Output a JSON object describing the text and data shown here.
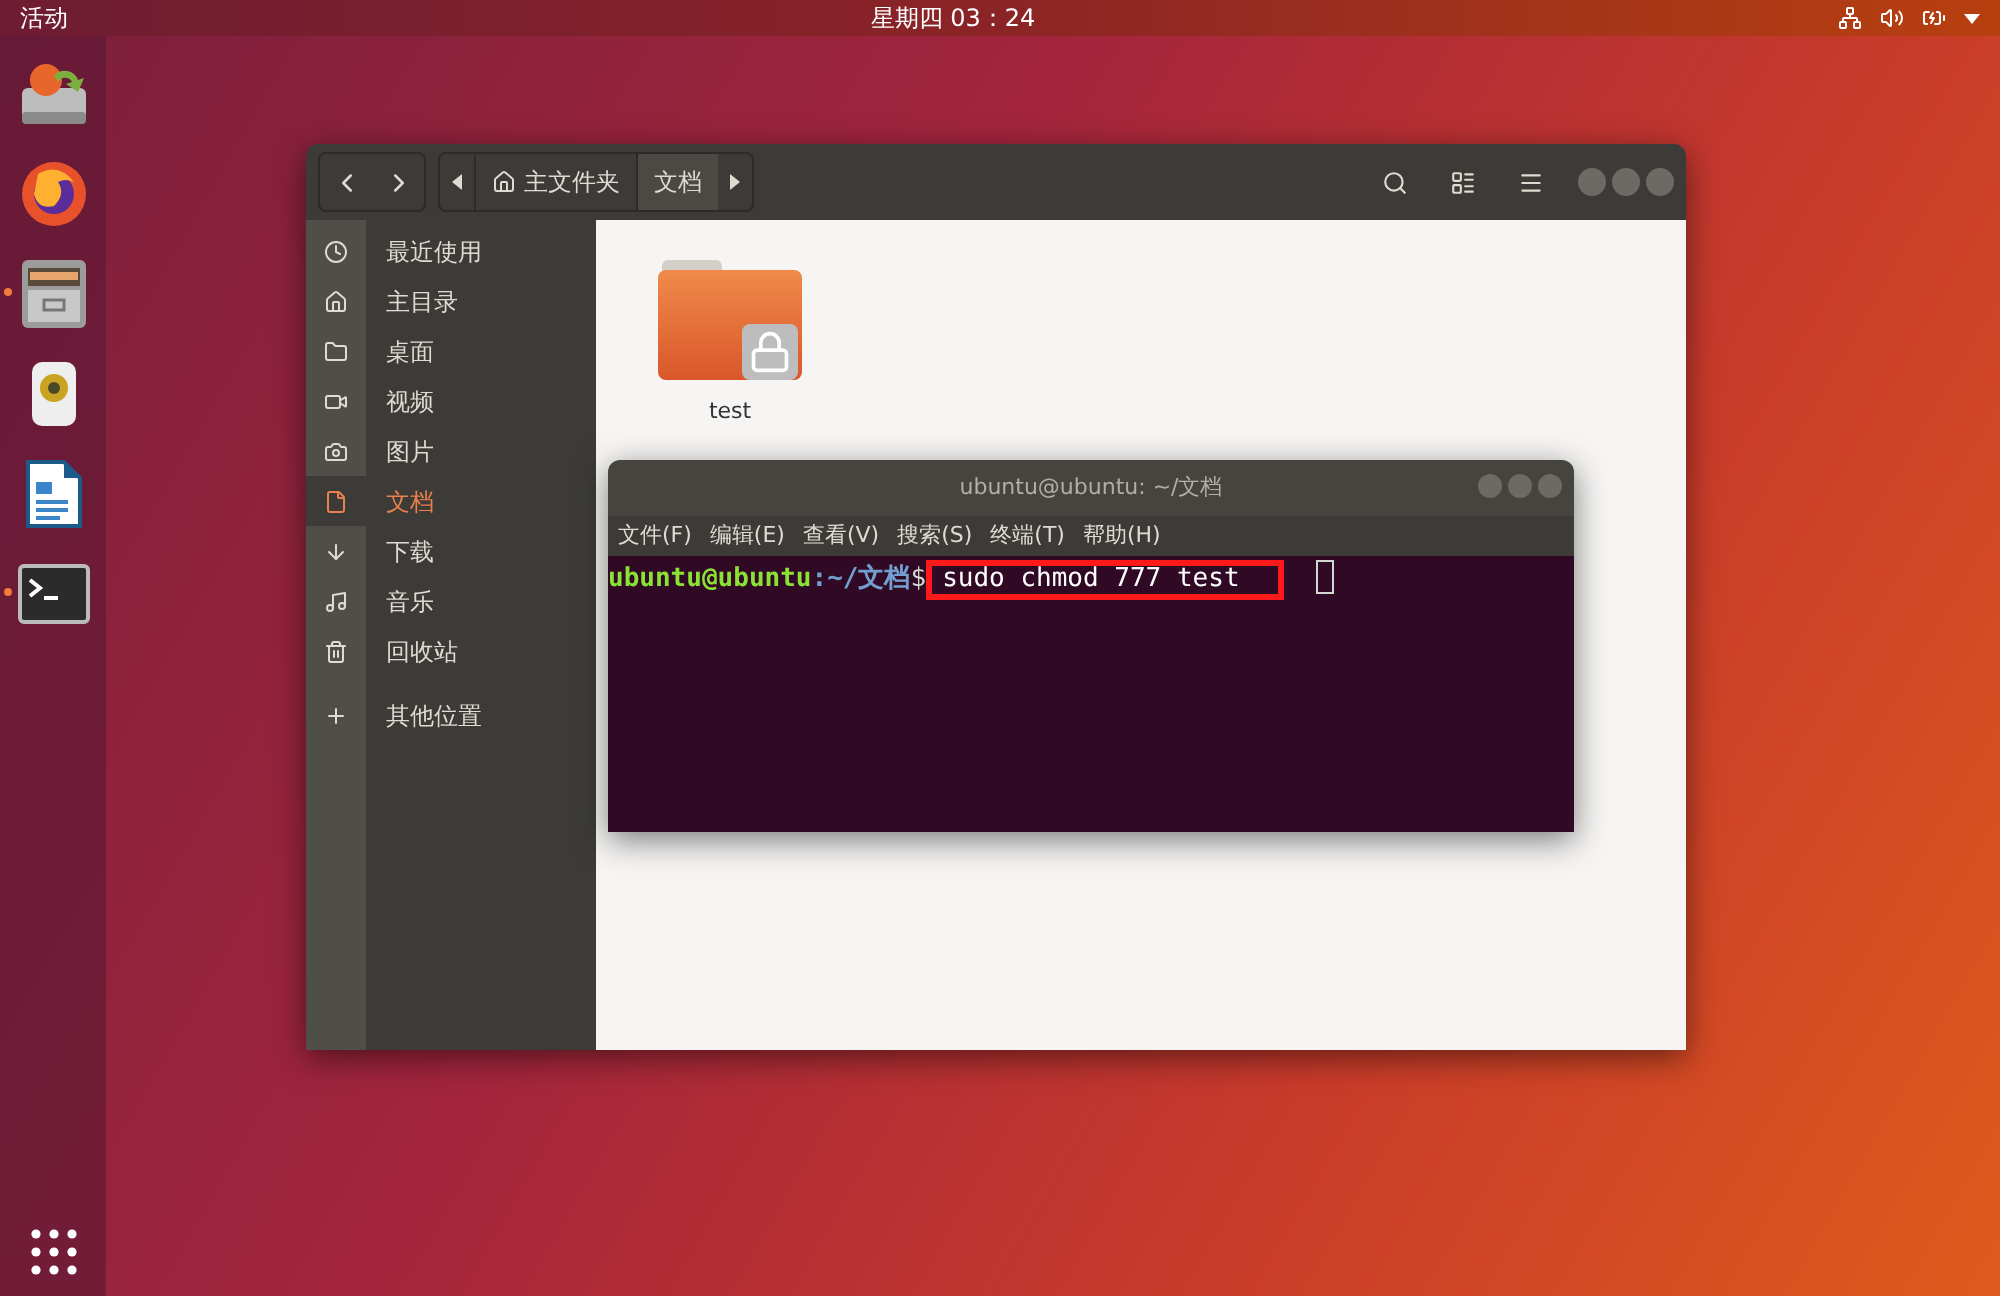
{
  "top_bar": {
    "activities": "活动",
    "clock": "星期四 03：24"
  },
  "dock": [
    {
      "kind": "installer",
      "running": false
    },
    {
      "kind": "browser",
      "running": false
    },
    {
      "kind": "files",
      "running": true
    },
    {
      "kind": "music",
      "running": false
    },
    {
      "kind": "writer",
      "running": false
    },
    {
      "kind": "terminal",
      "running": true
    }
  ],
  "files_window": {
    "breadcrumbs": [
      {
        "label": "主文件夹",
        "kind": "home",
        "selected": false
      },
      {
        "label": "文档",
        "kind": "folder",
        "selected": true
      }
    ],
    "sidebar": [
      {
        "label": "最近使用",
        "kind": "recent",
        "selected": false
      },
      {
        "label": "主目录",
        "kind": "home",
        "selected": false
      },
      {
        "label": "桌面",
        "kind": "desktop",
        "selected": false
      },
      {
        "label": "视频",
        "kind": "videos",
        "selected": false
      },
      {
        "label": "图片",
        "kind": "pictures",
        "selected": false
      },
      {
        "label": "文档",
        "kind": "documents",
        "selected": true
      },
      {
        "label": "下载",
        "kind": "downloads",
        "selected": false
      },
      {
        "label": "音乐",
        "kind": "music",
        "selected": false
      },
      {
        "label": "回收站",
        "kind": "trash",
        "selected": false
      },
      {
        "label": "其他位置",
        "kind": "other",
        "selected": false
      }
    ],
    "items": [
      {
        "name": "test",
        "locked": true
      }
    ]
  },
  "terminal": {
    "title": "ubuntu@ubuntu: ~/文档",
    "menu": [
      "文件(F)",
      "编辑(E)",
      "查看(V)",
      "搜索(S)",
      "终端(T)",
      "帮助(H)"
    ],
    "prompt_user": "ubuntu@ubuntu",
    "prompt_path": ":~/文档",
    "prompt_sign": "$",
    "command": "sudo chmod 777 test",
    "command_highlighted": true
  }
}
